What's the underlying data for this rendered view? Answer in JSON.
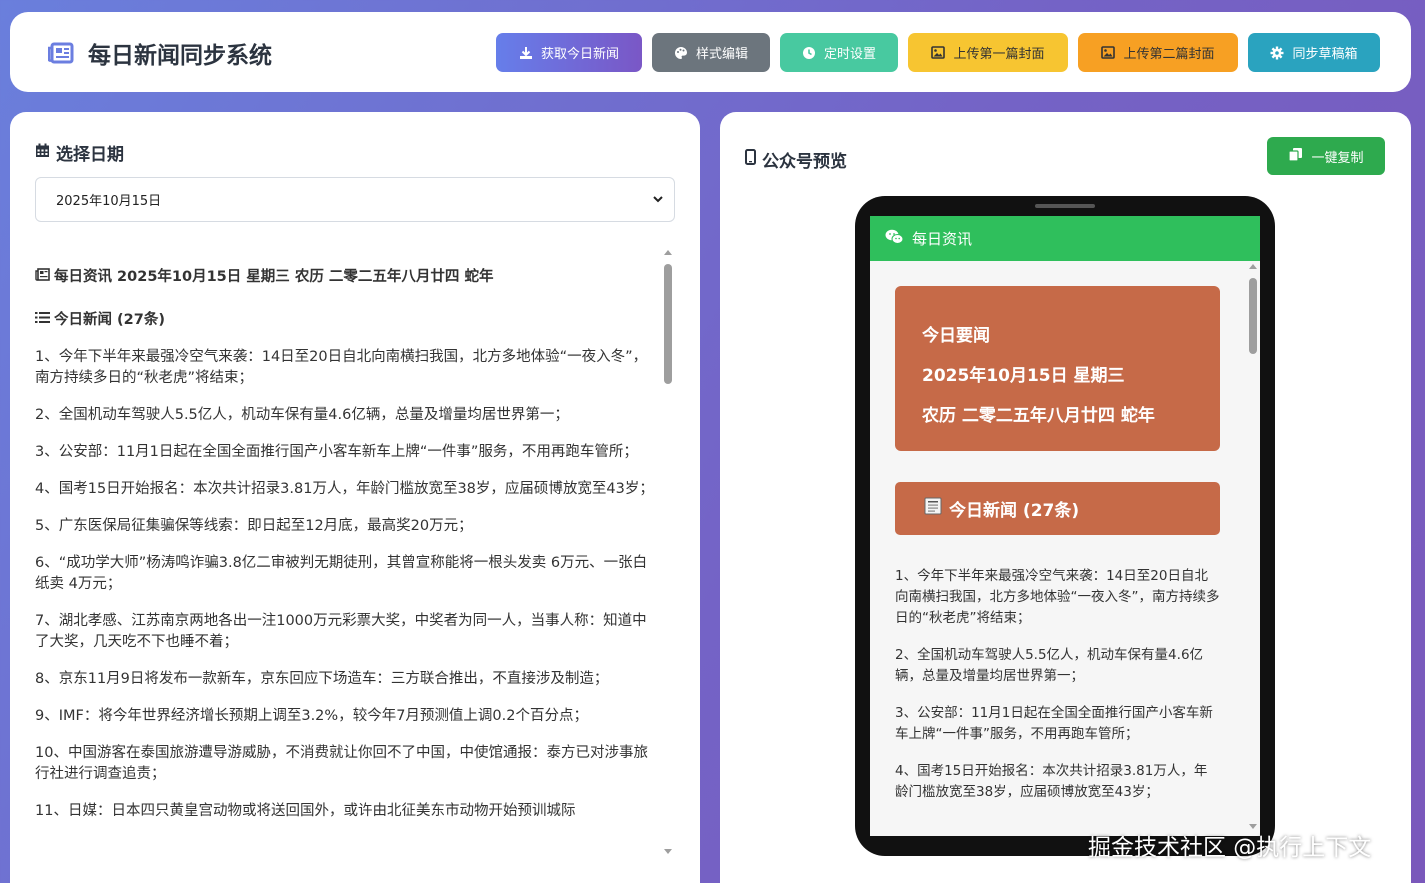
{
  "header": {
    "title": "每日新闻同步系统",
    "buttons": [
      {
        "label": "获取今日新闻",
        "icon": "download-icon",
        "color": "#6a5fd8"
      },
      {
        "label": "样式编辑",
        "icon": "palette-icon",
        "color": "#6c757d"
      },
      {
        "label": "定时设置",
        "icon": "clock-icon",
        "color": "#48c9a0"
      },
      {
        "label": "上传第一篇封面",
        "icon": "image-icon",
        "color": "#f7c531"
      },
      {
        "label": "上传第二篇封面",
        "icon": "image-icon",
        "color": "#f7a023"
      },
      {
        "label": "同步草稿箱",
        "icon": "gear-icon",
        "color": "#2aa3bf"
      }
    ]
  },
  "left": {
    "section_title": "选择日期",
    "selected_date": "2025年10月15日",
    "news_header": "每日资讯 2025年10月15日 星期三 农历 二零二五年八月廿四 蛇年",
    "news_subheader": "今日新闻 (27条)",
    "news_items": [
      "1、今年下半年来最强冷空气来袭：14日至20日自北向南横扫我国，北方多地体验“一夜入冬”，南方持续多日的“秋老虎”将结束；",
      "2、全国机动车驾驶人5.5亿人，机动车保有量4.6亿辆，总量及增量均居世界第一；",
      "3、公安部：11月1日起在全国全面推行国产小客车新车上牌“一件事”服务，不用再跑车管所；",
      "4、国考15日开始报名：本次共计招录3.81万人，年龄门槛放宽至38岁，应届硕博放宽至43岁；",
      "5、广东医保局征集骗保等线索：即日起至12月底，最高奖20万元；",
      "6、“成功学大师”杨涛鸣诈骗3.8亿二审被判无期徒刑，其曾宣称能将一根头发卖 6万元、一张白纸卖 4万元；",
      "7、湖北孝感、江苏南京两地各出一注1000万元彩票大奖，中奖者为同一人，当事人称：知道中了大奖，几天吃不下也睡不着；",
      "8、京东11月9日将发布一款新车，京东回应下场造车：三方联合推出，不直接涉及制造；",
      "9、IMF：将今年世界经济增长预期上调至3.2%，较今年7月预测值上调0.2个百分点；",
      "10、中国游客在泰国旅游遭导游威胁，不消费就让你回不了中国，中使馆通报：泰方已对涉事旅行社进行调查追责；",
      "11、日媒：日本四只黄皇宫动物或将送回国外，或许由北征美东市动物开始预训城际"
    ]
  },
  "right": {
    "section_title": "公众号预览",
    "copy_label": "一键复制",
    "phone": {
      "account_name": "每日资讯",
      "summary_lines": [
        "今日要闻",
        "2025年10月15日 星期三",
        "农历 二零二五年八月廿四 蛇年"
      ],
      "news_title": "今日新闻 (27条)",
      "news_items": [
        "1、今年下半年来最强冷空气来袭：14日至20日自北向南横扫我国，北方多地体验“一夜入冬”，南方持续多日的“秋老虎”将结束；",
        "2、全国机动车驾驶人5.5亿人，机动车保有量4.6亿辆，总量及增量均居世界第一；",
        "3、公安部：11月1日起在全国全面推行国产小客车新车上牌“一件事”服务，不用再跑车管所；",
        "4、国考15日开始报名：本次共计招录3.81万人，年龄门槛放宽至38岁，应届硕博放宽至43岁；"
      ]
    }
  },
  "watermark": "掘金技术社区 @执行上下文"
}
